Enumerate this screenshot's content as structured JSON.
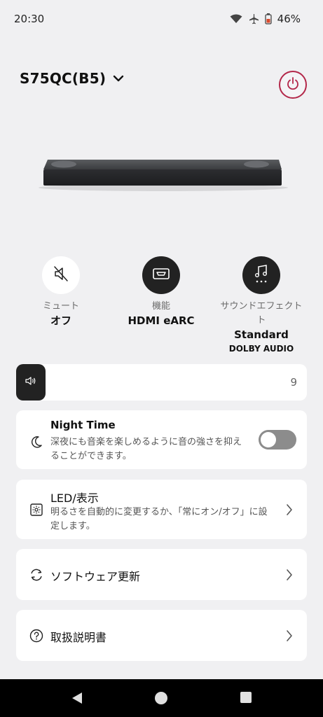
{
  "status": {
    "time": "20:30",
    "battery": "46%"
  },
  "device": {
    "name": "S75QC(B5)"
  },
  "controls": {
    "mute": {
      "label": "ミュート",
      "value": "オフ"
    },
    "function": {
      "label": "機能",
      "value": "HDMI eARC"
    },
    "sound_effect": {
      "label_line1": "サウンドエフェクト",
      "label_line2": "ト",
      "value": "Standard",
      "sub": "DOLBY AUDIO"
    }
  },
  "volume": {
    "value": "9",
    "level": 0.09
  },
  "night_time": {
    "title": "Night Time",
    "desc_line1": "深夜にも音楽を楽しめるように音の強さを抑え",
    "desc_line2": "ることができます。",
    "enabled": false
  },
  "led": {
    "title": "LED/表示",
    "desc_line1": "明るさを自動的に変更するか、「常にオン/オフ」に設",
    "desc_line2": "定します。"
  },
  "software_update": {
    "title": "ソフトウェア更新"
  },
  "manual": {
    "title": "取扱説明書"
  },
  "colors": {
    "accent_power": "#b3284a",
    "dark_button": "#222222",
    "background": "#f0f0f2"
  }
}
